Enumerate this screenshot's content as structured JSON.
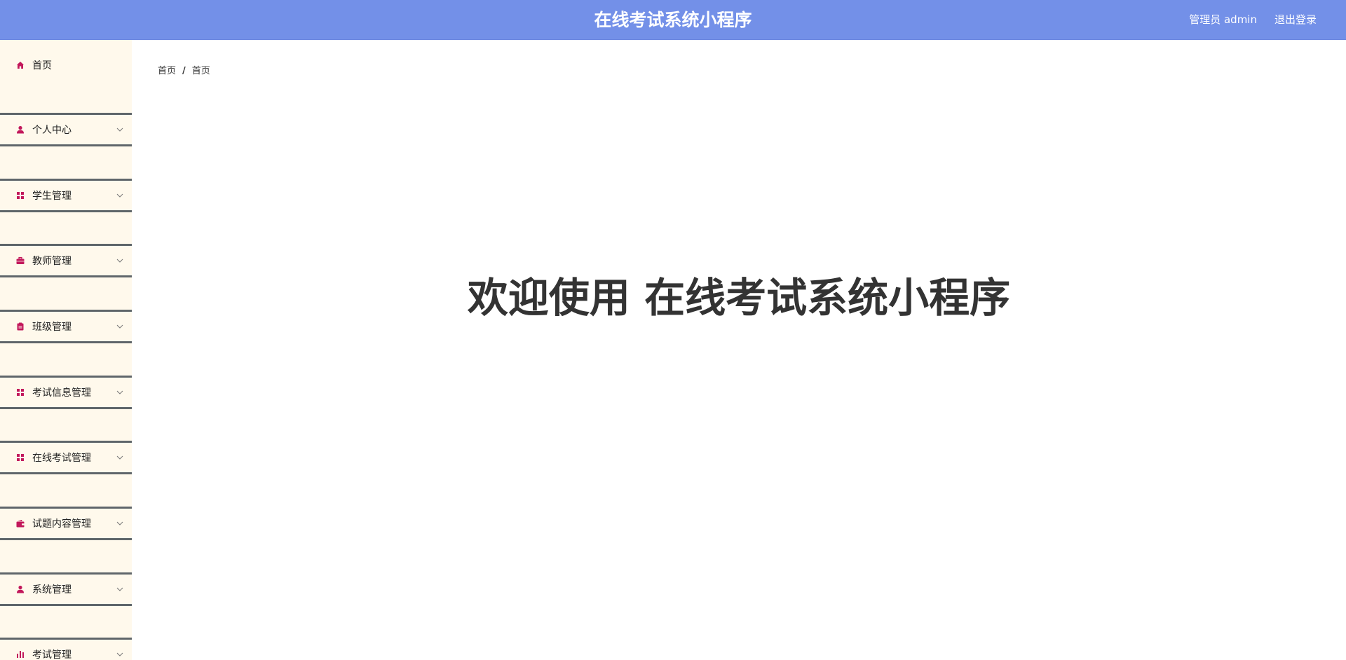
{
  "header": {
    "title": "在线考试系统小程序",
    "user_label": "管理员 admin",
    "logout_label": "退出登录"
  },
  "sidebar": {
    "items": [
      {
        "label": "首页",
        "icon": "home-icon"
      },
      {
        "label": "个人中心",
        "icon": "user-icon"
      },
      {
        "label": "学生管理",
        "icon": "grid-icon"
      },
      {
        "label": "教师管理",
        "icon": "briefcase-icon"
      },
      {
        "label": "班级管理",
        "icon": "clipboard-icon"
      },
      {
        "label": "考试信息管理",
        "icon": "grid-icon"
      },
      {
        "label": "在线考试管理",
        "icon": "grid-icon"
      },
      {
        "label": "试题内容管理",
        "icon": "wallet-icon"
      },
      {
        "label": "系统管理",
        "icon": "user-icon"
      },
      {
        "label": "考试管理",
        "icon": "bar-chart-icon"
      }
    ]
  },
  "breadcrumb": {
    "items": [
      "首页",
      "首页"
    ],
    "separator": "/"
  },
  "main": {
    "welcome": "欢迎使用 在线考试系统小程序"
  },
  "colors": {
    "header_bg": "#7390e8",
    "sidebar_bg": "#fff9ec",
    "icon_accent": "#c2185b",
    "divider": "#5f666a"
  }
}
